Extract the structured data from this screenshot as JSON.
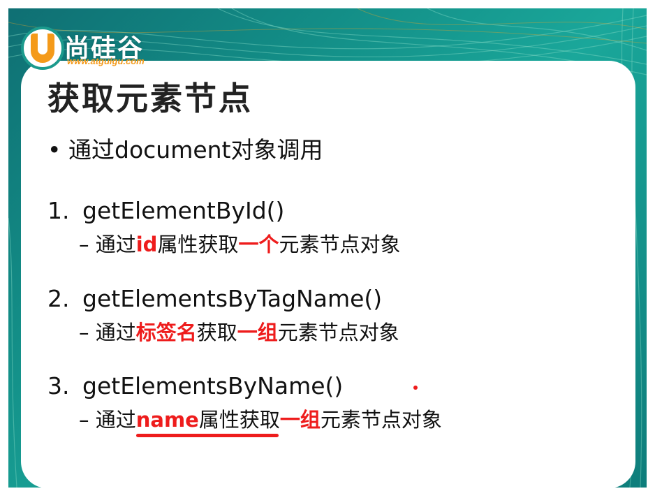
{
  "logo": {
    "name": "尚硅谷",
    "url": "www.atguigu.com"
  },
  "slide": {
    "title": "获取元素节点",
    "bullet": "通过document对象调用",
    "items": [
      {
        "number": "1.",
        "method": "getElementById()",
        "dash": "–",
        "desc": [
          {
            "text": "通过",
            "red": false
          },
          {
            "text": "id",
            "red": true
          },
          {
            "text": "属性获取",
            "red": false
          },
          {
            "text": "一个",
            "red": true
          },
          {
            "text": "元素节点对象",
            "red": false
          }
        ]
      },
      {
        "number": "2.",
        "method": "getElementsByTagName()",
        "dash": "–",
        "desc": [
          {
            "text": "通过",
            "red": false
          },
          {
            "text": "标签名",
            "red": true
          },
          {
            "text": "获取",
            "red": false
          },
          {
            "text": "一组",
            "red": true
          },
          {
            "text": "元素节点对象",
            "red": false
          }
        ]
      },
      {
        "number": "3.",
        "method": "getElementsByName()",
        "dash": "–",
        "desc": [
          {
            "text": "通过",
            "red": false
          },
          {
            "text": "name",
            "red": true
          },
          {
            "text": "属性获取",
            "red": false
          },
          {
            "text": "一组",
            "red": true
          },
          {
            "text": "元素节点对象",
            "red": false
          }
        ]
      }
    ]
  },
  "colors": {
    "accent_red": "#ee1c1c",
    "frame_teal": "#138e87",
    "logo_orange": "#f49a1a"
  }
}
